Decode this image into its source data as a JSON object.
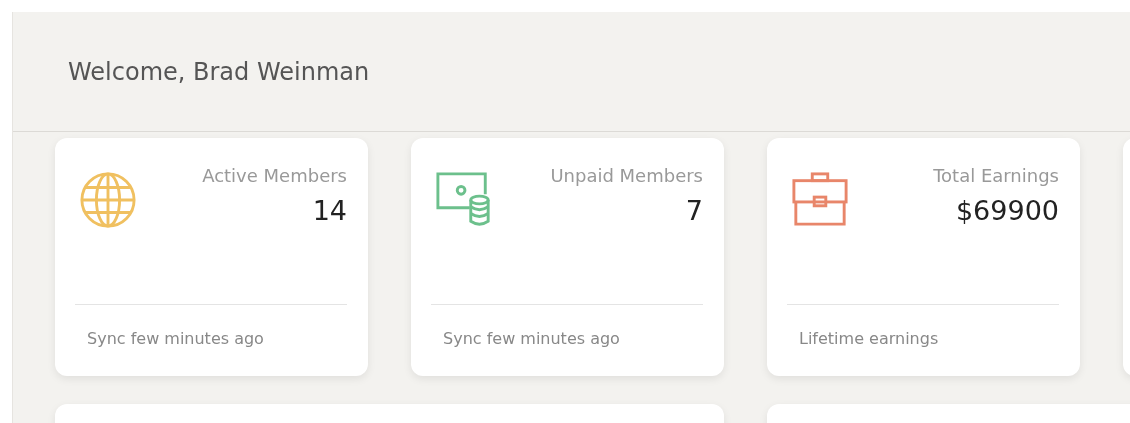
{
  "header": {
    "title": "Welcome, Brad Weinman"
  },
  "cards": [
    {
      "kind": "globe",
      "color": "#f0c060",
      "label": "Active Members",
      "value": "14",
      "footer": "Sync few minutes ago"
    },
    {
      "kind": "money",
      "color": "#6cc08c",
      "label": "Unpaid Members",
      "value": "7",
      "footer": "Sync few minutes ago"
    },
    {
      "kind": "briefcase",
      "color": "#e8866a",
      "label": "Total Earnings",
      "value": "$69900",
      "footer": "Lifetime earnings"
    }
  ]
}
